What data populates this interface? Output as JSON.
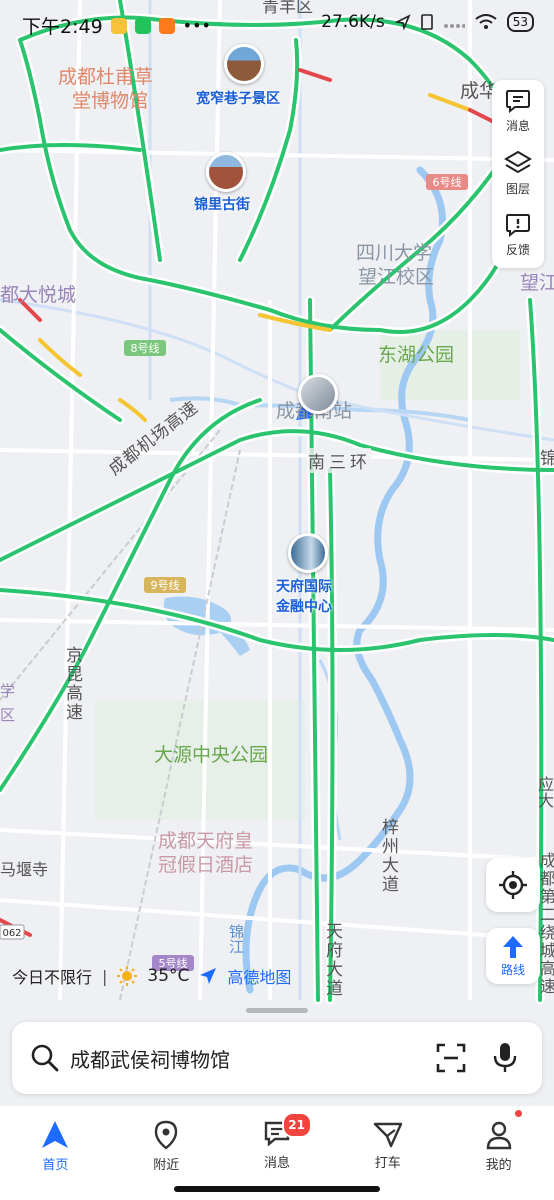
{
  "status_bar": {
    "time": "下午2:49",
    "network_speed": "27.6K/s",
    "battery": "53",
    "icons": [
      "weibo-icon",
      "wechat-icon",
      "mi-icon",
      "more-dots-icon",
      "location-arrow-icon",
      "sim-icon",
      "signal-icon",
      "wifi-icon",
      "battery-icon"
    ]
  },
  "map": {
    "district_labels": [
      {
        "text": "成都杜甫草",
        "color": "#e0886a"
      },
      {
        "text": "堂博物馆",
        "color": "#e0886a"
      },
      {
        "text": "四川大学",
        "color": "#8a96a6"
      },
      {
        "text": "望江校区",
        "color": "#8a96a6"
      },
      {
        "text": "都大悦城",
        "color": "#9a85b8"
      },
      {
        "text": "东湖公园",
        "color": "#6aa84f"
      },
      {
        "text": "大源中央公园",
        "color": "#6aa84f"
      },
      {
        "text": "成都天府皇",
        "color": "#c99aa6"
      },
      {
        "text": "冠假日酒店",
        "color": "#c99aa6"
      },
      {
        "text": "成都南站",
        "color": "#8a96a6"
      },
      {
        "text": "望江",
        "color": "#9a85b8"
      },
      {
        "text": "成华",
        "color": "#555555"
      },
      {
        "text": "青羊区",
        "color": "#555555"
      }
    ],
    "road_labels": [
      {
        "text": "成都机场高速",
        "color": "#555555"
      },
      {
        "text": "南三环",
        "color": "#555555"
      },
      {
        "text": "京昆高速",
        "color": "#555555"
      },
      {
        "text": "梓州大道",
        "color": "#555555"
      },
      {
        "text": "天府大道",
        "color": "#555555"
      },
      {
        "text": "锦江",
        "color": "#5b8fd0"
      },
      {
        "text": "成都第二绕城高速",
        "color": "#555555"
      },
      {
        "text": "锦",
        "color": "#555555"
      },
      {
        "text": "应大",
        "color": "#555555"
      },
      {
        "text": "马堰寺",
        "color": "#555555"
      },
      {
        "text": "学",
        "color": "#9a85b8"
      },
      {
        "text": "区",
        "color": "#9a85b8"
      }
    ],
    "metro_labels": [
      "6号线",
      "8号线",
      "9号线",
      "5号线"
    ],
    "road_shield": "062",
    "pois": [
      {
        "name": "宽窄巷子景区"
      },
      {
        "name": "锦里古街"
      },
      {
        "name": "天府国际",
        "name2": "金融中心"
      }
    ]
  },
  "right_panel": {
    "messages": "消息",
    "layers": "图层",
    "feedback": "反馈"
  },
  "route_button": "路线",
  "info_strip": {
    "restriction": "今日不限行",
    "temperature": "35°C",
    "brand": "高德地图"
  },
  "search": {
    "placeholder": "成都武侯祠博物馆"
  },
  "bottom_nav": {
    "items": [
      {
        "label": "首页",
        "active": true
      },
      {
        "label": "附近"
      },
      {
        "label": "消息",
        "badge": "21"
      },
      {
        "label": "打车"
      },
      {
        "label": "我的"
      }
    ]
  },
  "colors": {
    "accent": "#1e6bff",
    "road_green": "#2bc46e",
    "road_yellow": "#f4c431",
    "road_red": "#e4474b",
    "river": "#9cc8f1",
    "badge": "#f0453f"
  }
}
